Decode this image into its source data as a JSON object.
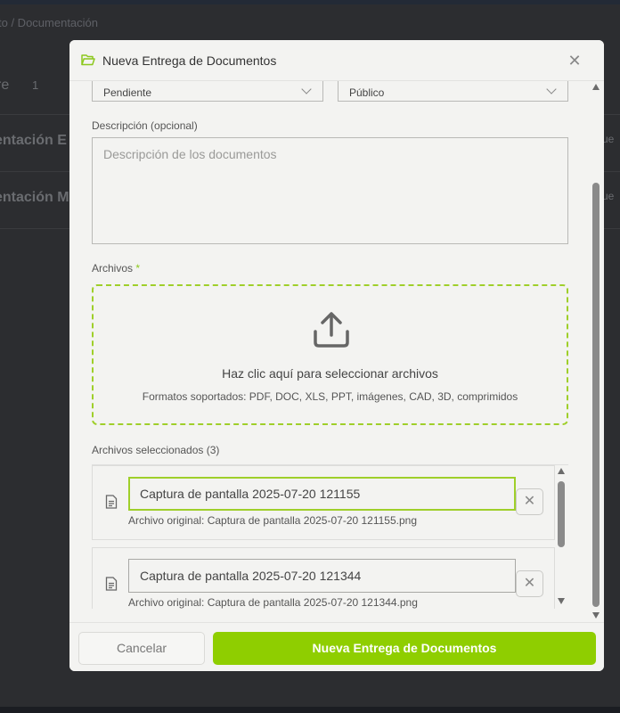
{
  "background": {
    "breadcrumb": "to / Documentación",
    "header_text": "re",
    "header_count": "1",
    "rows": [
      {
        "label": "entación E",
        "right": "ue"
      },
      {
        "label": "entación M",
        "right": "ue"
      }
    ]
  },
  "modal": {
    "title": "Nueva Entrega de Documentos",
    "folder_icon": "folder-open-icon",
    "close_icon": "close-icon",
    "status_value": "Pendiente",
    "visibility_value": "Público",
    "description_label": "Descripción (opcional)",
    "description_placeholder": "Descripción de los documentos",
    "files_label": "Archivos",
    "required_mark": "*",
    "dropzone": {
      "icon": "upload-icon",
      "main_text": "Haz clic aquí para seleccionar archivos",
      "formats_text": "Formatos soportados: PDF, DOC, XLS, PPT, imágenes, CAD, 3D, comprimidos"
    },
    "selected_label": "Archivos seleccionados (3)",
    "files": [
      {
        "name": "Captura de pantalla 2025-07-20 121155",
        "original": "Archivo original: Captura de pantalla 2025-07-20 121155.png"
      },
      {
        "name": "Captura de pantalla 2025-07-20 121344",
        "original": "Archivo original: Captura de pantalla 2025-07-20 121344.png"
      }
    ],
    "cancel_label": "Cancelar",
    "submit_label": "Nueva Entrega de Documentos",
    "accent_color": "#8fce00"
  }
}
